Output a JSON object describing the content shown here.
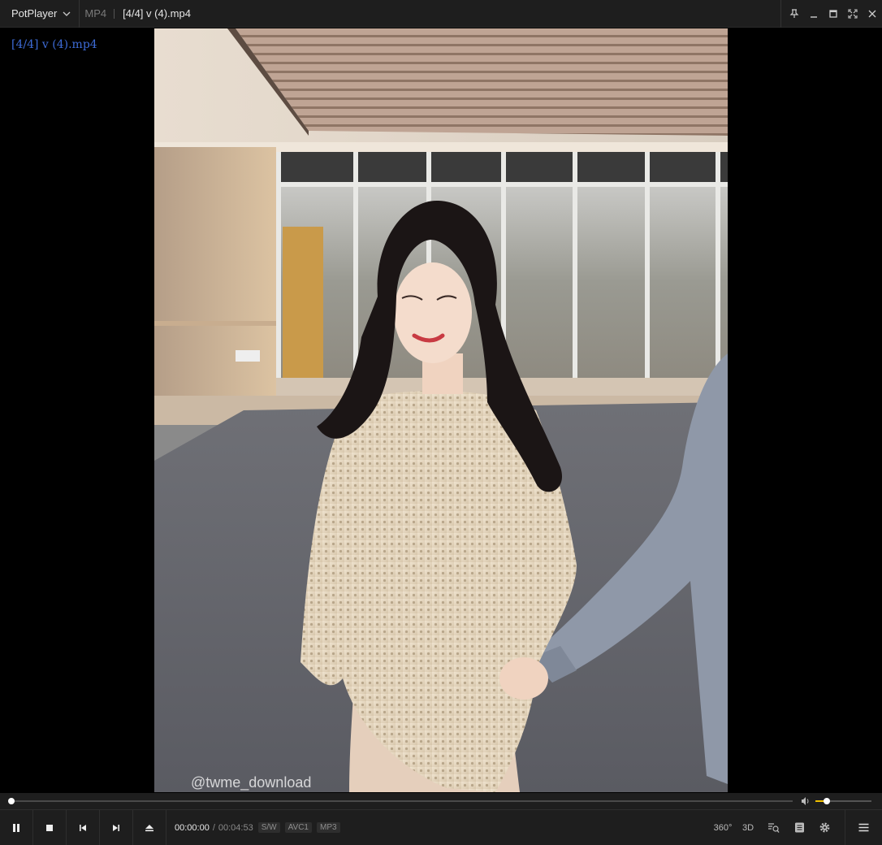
{
  "titlebar": {
    "app_name": "PotPlayer",
    "format": "MP4",
    "title": "[4/4] v (4).mp4"
  },
  "osd": {
    "filename": "[4/4] v (4).mp4"
  },
  "video": {
    "watermark": "@twme_download"
  },
  "playback": {
    "current_time": "00:00:00",
    "separator": "/",
    "duration": "00:04:53",
    "progress": 0.0,
    "volume": 0.2,
    "tags": [
      "S/W",
      "AVC1",
      "MP3"
    ]
  },
  "tools": {
    "vr_label": "360°",
    "stereo_label": "3D"
  },
  "colors": {
    "osd_text": "#3d6bd6",
    "volume_fill": "#f0c000",
    "bar_bg": "#1e1e1e"
  }
}
